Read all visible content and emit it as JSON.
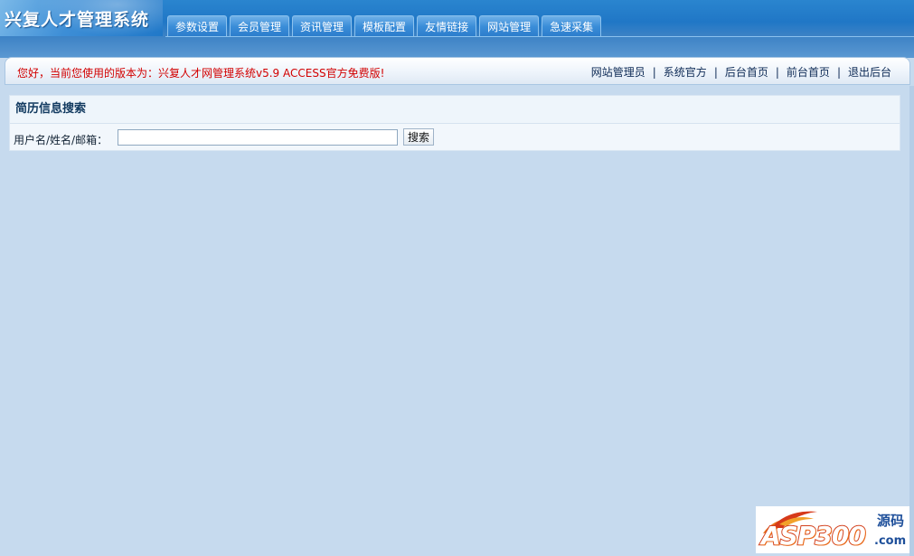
{
  "app": {
    "title": "兴复人才管理系统"
  },
  "nav": {
    "tabs": [
      {
        "label": "参数设置"
      },
      {
        "label": "会员管理"
      },
      {
        "label": "资讯管理"
      },
      {
        "label": "模板配置"
      },
      {
        "label": "友情链接"
      },
      {
        "label": "网站管理"
      },
      {
        "label": "急速采集"
      }
    ]
  },
  "infobar": {
    "welcome": "您好，当前您使用的版本为：兴复人才网管理系统v5.9 ACCESS官方免费版!",
    "links": [
      {
        "label": "网站管理员"
      },
      {
        "label": "系统官方"
      },
      {
        "label": "后台首页"
      },
      {
        "label": "前台首页"
      },
      {
        "label": "退出后台"
      }
    ],
    "separator": "|"
  },
  "search_panel": {
    "title": "简历信息搜索",
    "field_label": "用户名/姓名/邮箱：",
    "input_value": "",
    "button_label": "搜索"
  },
  "watermark": {
    "main_text": "ASP300",
    "side_text": "源码",
    "domain_text": ".com"
  },
  "colors": {
    "background": "#c6daee",
    "header_blue": "#2077c6",
    "welcome_red": "#d20000",
    "link_navy": "#0d2a55"
  }
}
